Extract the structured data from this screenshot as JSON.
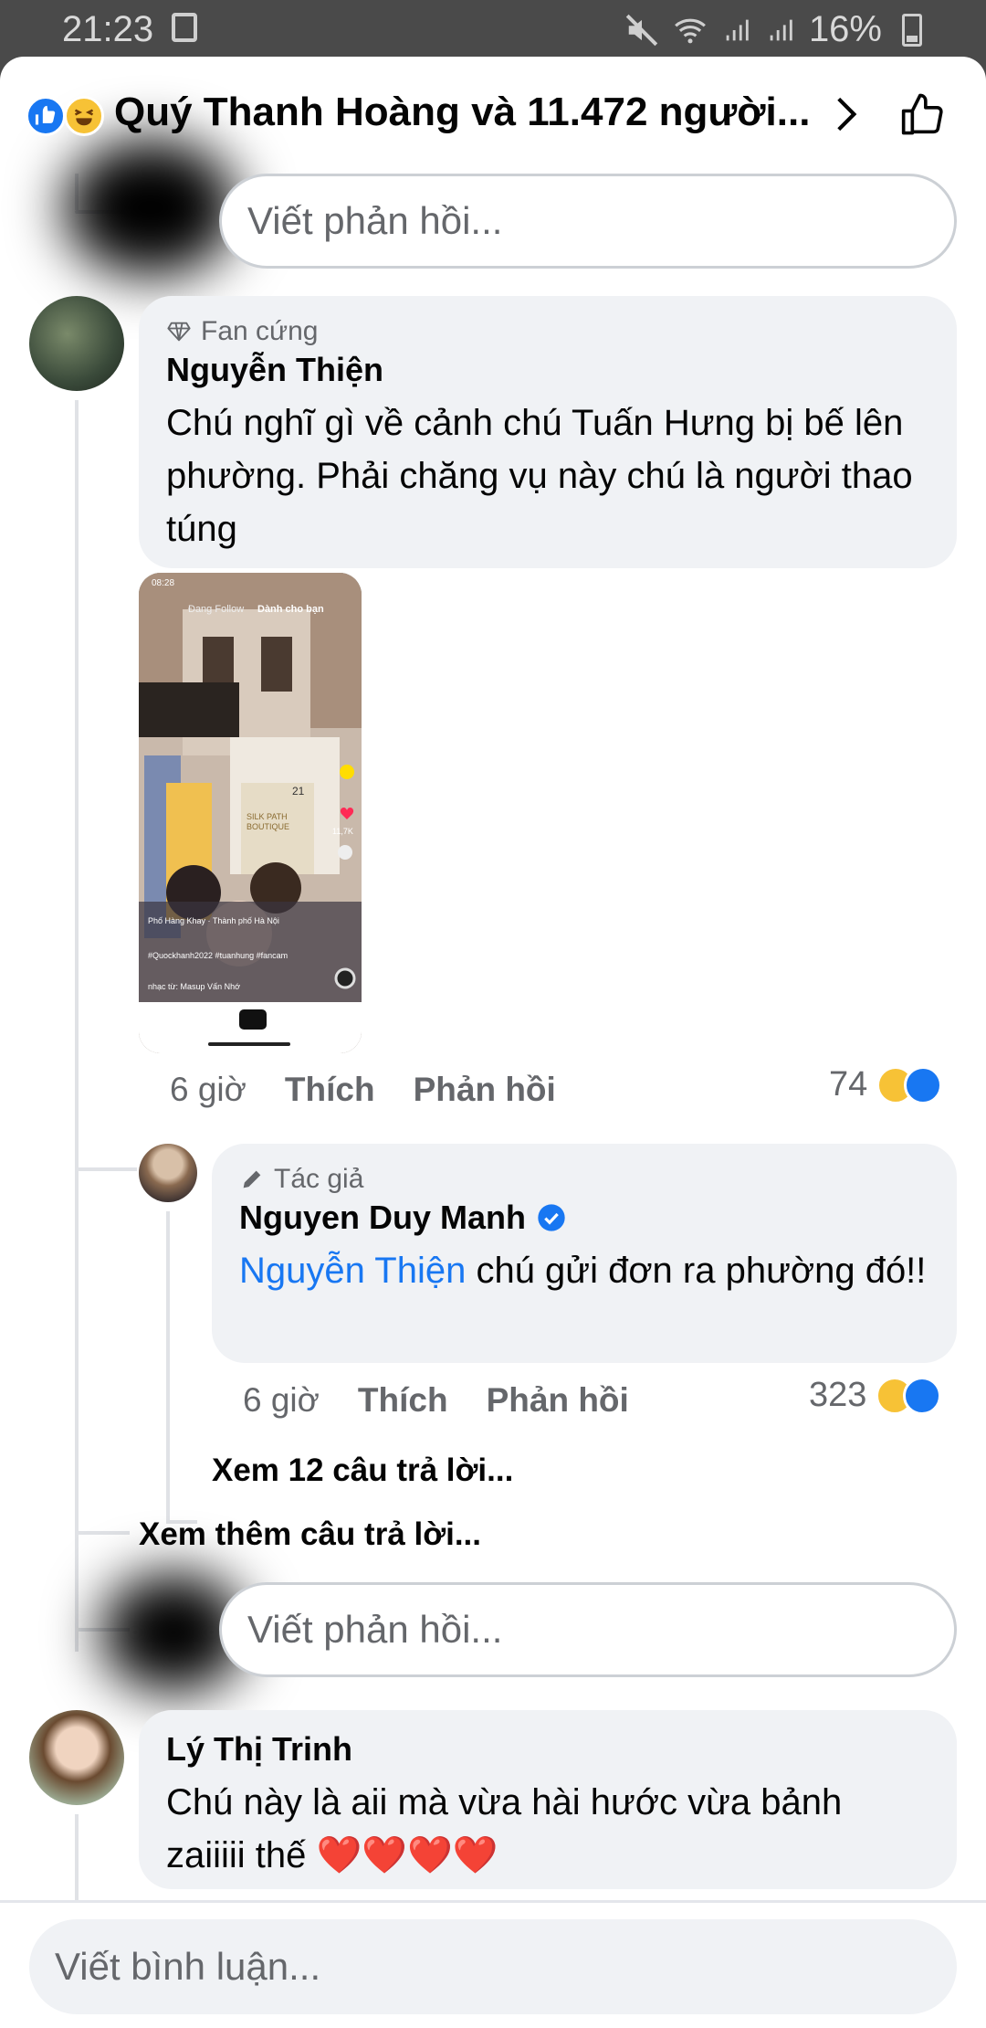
{
  "status_bar": {
    "time": "21:23",
    "battery": "16%"
  },
  "header": {
    "title": "Quý Thanh Hoàng và 11.472 người..."
  },
  "reply_placeholder": "Viết phản hồi...",
  "comment_input_placeholder": "Viết bình luận...",
  "comments": [
    {
      "badge": "Fan cứng",
      "author": "Nguyễn Thiện",
      "text": "Chú nghĩ gì về cảnh chú Tuấn Hưng bị bế lên phường. Phải chăng vụ này chú là người thao túng",
      "time": "6 giờ",
      "like_label": "Thích",
      "reply_label": "Phản hồi",
      "reaction_count": "74",
      "video": {
        "status_time": "08:28",
        "tab_following": "Đang Follow",
        "tab_foryou": "Dành cho bạn",
        "location": "Phố Hàng Khay · Thành phố Hà Nội",
        "shop_sign": "SILK PATH BOUTIQUE",
        "house_number": "21",
        "likes": "11,7K",
        "hashtags": "#Quockhanh2022 #tuanhung #fancam",
        "music": "nhạc từ: Masup Vấn Nhớ"
      },
      "reply": {
        "badge": "Tác giả",
        "author": "Nguyen Duy Manh",
        "mention": "Nguyễn Thiện",
        "text": " chú gửi đơn ra phường đó!!",
        "time": "6 giờ",
        "like_label": "Thích",
        "reply_label": "Phản hồi",
        "reaction_count": "323"
      },
      "view_replies": "Xem 12 câu trả lời...",
      "view_more": "Xem thêm câu trả lời..."
    },
    {
      "author": "Lý Thị Trinh",
      "text": "Chú này là aii mà vừa hài hước vừa bảnh zaiiiii thế ❤️❤️❤️❤️"
    }
  ],
  "colors": {
    "accent": "#1877f2",
    "bubble": "#f0f2f5",
    "muted": "#65676b"
  }
}
